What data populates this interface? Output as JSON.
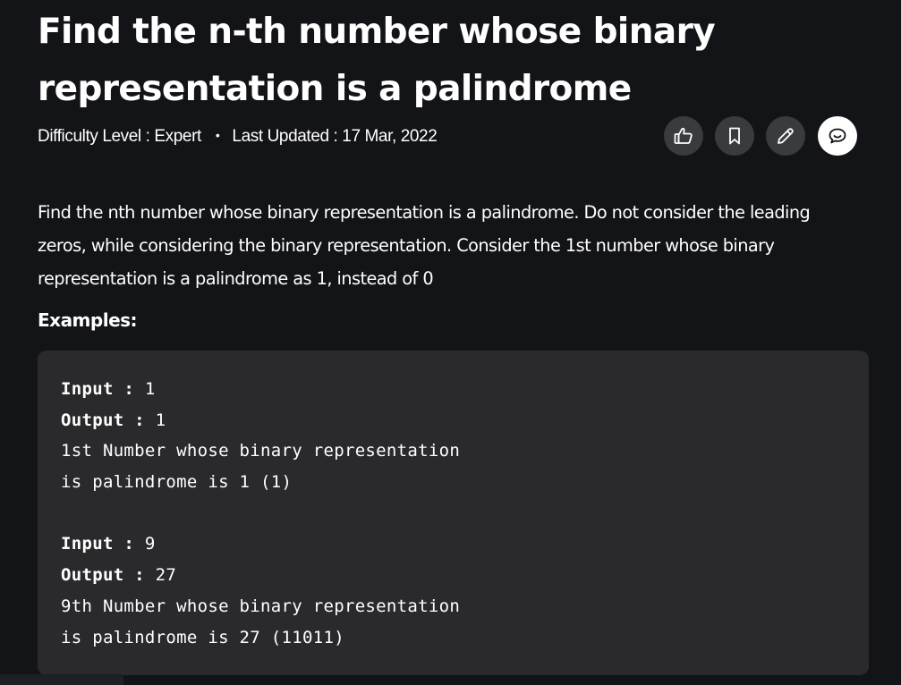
{
  "article": {
    "title": "Find the n-th number whose binary representation is a palindrome",
    "difficulty": "Difficulty Level : Expert",
    "dot": "•",
    "last_updated": "Last Updated : 17 Mar, 2022",
    "description": "Find the nth number whose binary representation is a palindrome. Do not consider the leading zeros, while considering the binary representation. Consider the 1st number whose binary representation is a palindrome as 1, instead of 0",
    "examples_label": "Examples:"
  },
  "actions": [
    {
      "name": "like",
      "icon": "thumbs-up-icon"
    },
    {
      "name": "bookmark",
      "icon": "bookmark-icon"
    },
    {
      "name": "edit",
      "icon": "pencil-icon"
    },
    {
      "name": "comment",
      "icon": "chat-bubble-icon"
    }
  ],
  "examples": [
    {
      "input_label": "Input :",
      "input_value": " 1",
      "output_label": "Output :",
      "output_value": " 1",
      "explanation_1": "1st Number whose binary representation",
      "explanation_2": "is palindrome is 1 (1)"
    },
    {
      "input_label": "Input :",
      "input_value": " 9",
      "output_label": "Output :",
      "output_value": " 27",
      "explanation_1": "9th Number whose binary representation",
      "explanation_2": "is palindrome is 27 (11011)"
    }
  ],
  "colors": {
    "background": "#131417",
    "code_background": "#2a2a2c",
    "button_background": "#3a3b3e",
    "highlight_button": "#ffffff",
    "text": "#ffffff"
  }
}
